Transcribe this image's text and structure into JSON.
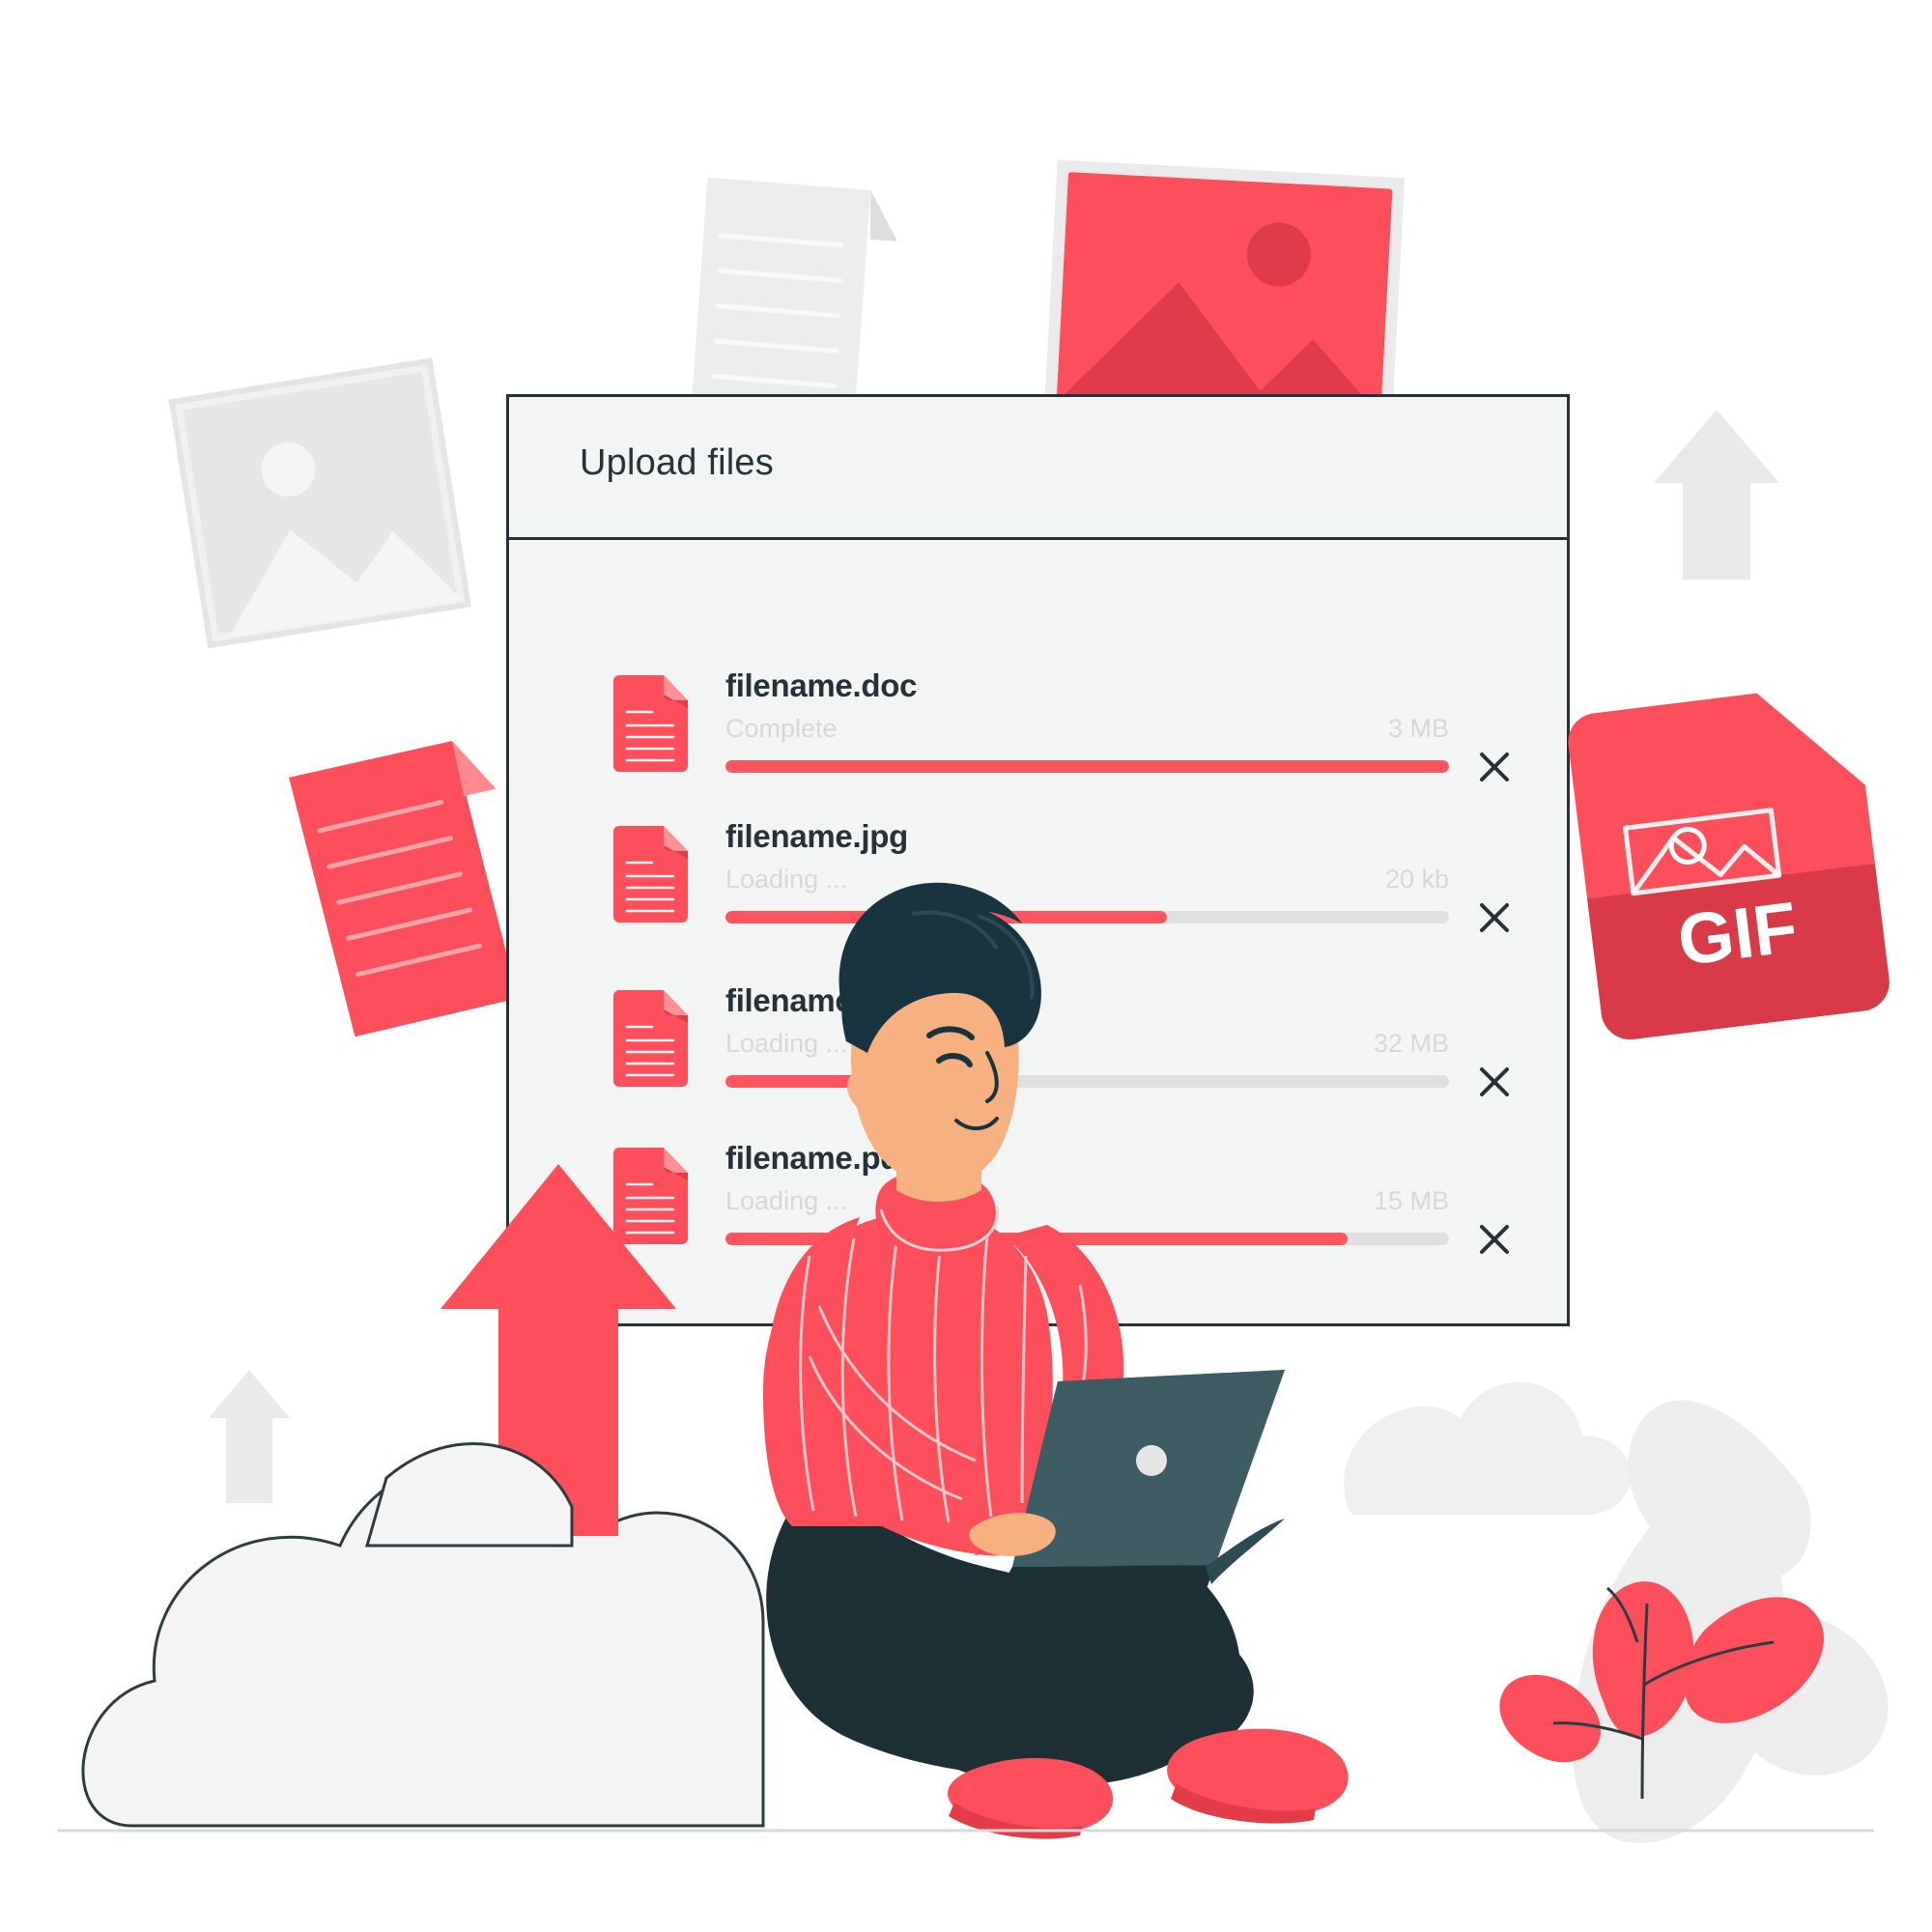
{
  "illustration": {
    "theme": "file upload / cloud upload concept illustration",
    "background_color": "#ffffff",
    "accent_color": "#ff5560",
    "accent_dark_color": "#d93a48",
    "ink_color": "#263238",
    "panel_bg_color": "#f3f4f4",
    "muted_text_color": "#d6d7d8",
    "track_color": "#dfe0e0",
    "laptop_color": "#3e5c63",
    "skin_color": "#f7b080",
    "hair_color": "#183441"
  },
  "panel": {
    "title": "Upload files",
    "files": [
      {
        "name": "filename.doc",
        "status": "Complete",
        "size": "3 MB",
        "progress": 100,
        "icon": "document-file-icon"
      },
      {
        "name": "filename.jpg",
        "status": "Loading ...",
        "size": "20 kb",
        "progress": 61,
        "icon": "document-file-icon"
      },
      {
        "name": "filename.png",
        "status": "Loading ...",
        "size": "32 MB",
        "progress": 36,
        "icon": "document-file-icon"
      },
      {
        "name": "filename.pdf",
        "status": "Loading ...",
        "size": "15 MB",
        "progress": 86,
        "icon": "document-file-icon"
      }
    ],
    "remove_icon": "close-x-icon"
  },
  "decorations": {
    "gif_badge_label": "GIF",
    "items": [
      {
        "name": "photo-placeholder-grey-left",
        "label": ""
      },
      {
        "name": "document-sheet-grey-top",
        "label": ""
      },
      {
        "name": "photo-thumbnail-red-top",
        "label": ""
      },
      {
        "name": "document-sheet-red-left",
        "label": ""
      },
      {
        "name": "upload-arrow-grey-right",
        "label": ""
      },
      {
        "name": "upload-arrow-grey-small-left",
        "label": ""
      },
      {
        "name": "upload-arrow-red-large",
        "label": ""
      },
      {
        "name": "cloud-shape",
        "label": ""
      },
      {
        "name": "plant-leaf-decoration",
        "label": ""
      },
      {
        "name": "gif-file-badge",
        "label": "GIF"
      }
    ]
  }
}
